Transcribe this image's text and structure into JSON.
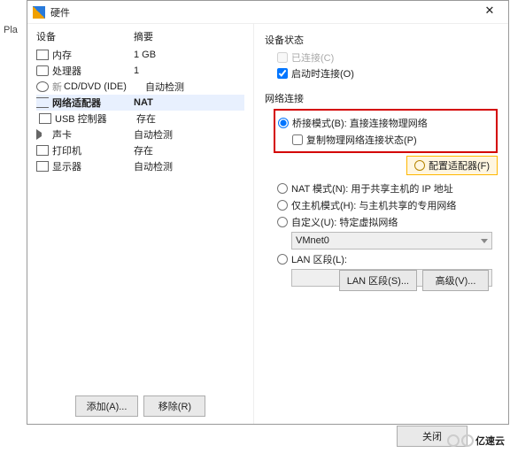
{
  "behind_text": "Pla",
  "title": "硬件",
  "headers": {
    "device": "设备",
    "summary": "摘要"
  },
  "devices": [
    {
      "icon": "ic-mem",
      "name": "内存",
      "summary": "1 GB"
    },
    {
      "icon": "ic-cpu",
      "name": "处理器",
      "summary": "1"
    },
    {
      "icon": "ic-cd",
      "prefix": "新 ",
      "name": "CD/DVD (IDE)",
      "summary": "自动检测"
    },
    {
      "icon": "ic-net",
      "name": "网络适配器",
      "summary": "NAT",
      "selected": true
    },
    {
      "icon": "ic-usb",
      "name": "USB 控制器",
      "summary": "存在"
    },
    {
      "icon": "ic-snd",
      "name": "声卡",
      "summary": "自动检测"
    },
    {
      "icon": "ic-prn",
      "name": "打印机",
      "summary": "存在"
    },
    {
      "icon": "ic-disp",
      "name": "显示器",
      "summary": "自动检测"
    }
  ],
  "btn": {
    "add": "添加(A)...",
    "remove": "移除(R)",
    "close": "关闭",
    "lan": "LAN 区段(S)...",
    "adv": "高级(V)...",
    "cfg": "配置适配器(F)"
  },
  "status": {
    "title": "设备状态",
    "connected": "已连接(C)",
    "onstart": "启动时连接(O)"
  },
  "net": {
    "title": "网络连接",
    "bridge": "桥接模式(B): 直接连接物理网络",
    "replicate": "复制物理网络连接状态(P)",
    "nat": "NAT 模式(N): 用于共享主机的 IP 地址",
    "host": "仅主机模式(H): 与主机共享的专用网络",
    "custom": "自定义(U): 特定虚拟网络",
    "vnet": "VMnet0",
    "lan": "LAN 区段(L):"
  },
  "watermark": "亿速云"
}
